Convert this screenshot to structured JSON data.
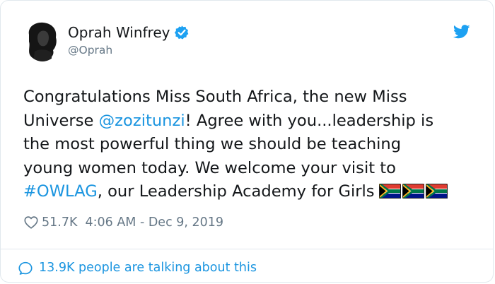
{
  "author": {
    "display_name": "Oprah Winfrey",
    "handle": "@Oprah",
    "verified": true,
    "avatar_icon": "profile-photo"
  },
  "tweet": {
    "lines": [
      [
        {
          "text": "Congratulations Miss South Africa, the new Miss",
          "type": "text"
        }
      ],
      [
        {
          "text": "Universe ",
          "type": "text"
        },
        {
          "text": "@zozitunzi",
          "type": "mention"
        },
        {
          "text": "! Agree with you...leadership is",
          "type": "text"
        }
      ],
      [
        {
          "text": "the most powerful thing we should be teaching",
          "type": "text"
        }
      ],
      [
        {
          "text": "young women today. We welcome your visit to",
          "type": "text"
        }
      ],
      [
        {
          "text": "#OWLAG",
          "type": "hashtag"
        },
        {
          "text": ", our Leadership Academy for Girls",
          "type": "text"
        }
      ]
    ],
    "emoji": [
      "south-africa-flag",
      "south-africa-flag",
      "south-africa-flag"
    ]
  },
  "meta": {
    "likes": "51.7K",
    "timestamp": "4:06 AM - Dec 9, 2019"
  },
  "footer": {
    "talking_text": "13.9K people are talking about this"
  },
  "colors": {
    "link": "#1b95e0",
    "text": "#14171a",
    "secondary": "#657786",
    "verified_badge": "#1da1f2",
    "twitter_bird": "#1da1f2",
    "border": "#e1e8ed"
  },
  "icons": {
    "verified": "verified-badge-icon",
    "brand": "twitter-bird-icon",
    "like": "heart-icon",
    "reply": "speech-bubble-icon"
  }
}
